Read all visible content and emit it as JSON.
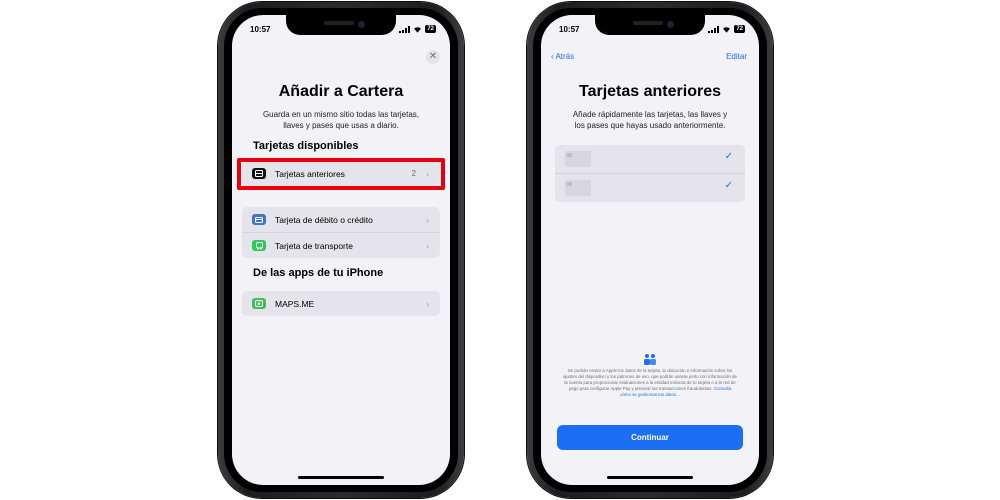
{
  "colors": {
    "accent": "#1f6ff2",
    "highlight": "#e8000c",
    "card_icon": "#3e78c4",
    "transit_icon": "#34c759",
    "maps_icon": "#3fbf57"
  },
  "left": {
    "status": {
      "time": "10:57",
      "battery": "72"
    },
    "close_label": "✕",
    "title": "Añadir a Cartera",
    "description": "Guarda en un mismo sitio todas las tarjetas, llaves y pases que usas a diario.",
    "section_available": "Tarjetas disponibles",
    "previous_cards": {
      "label": "Tarjetas anteriores",
      "count": "2",
      "icon": "wallet-icon"
    },
    "rows": [
      {
        "label": "Tarjeta de débito o crédito",
        "icon": "credit-card-icon"
      },
      {
        "label": "Tarjeta de transporte",
        "icon": "train-icon"
      }
    ],
    "section_apps": "De las apps de tu iPhone",
    "app": {
      "label": "MAPS.ME",
      "icon": "maps-me-icon"
    }
  },
  "right": {
    "status": {
      "time": "10:57",
      "battery": "72"
    },
    "back_label": "Atrás",
    "edit_label": "Editar",
    "title": "Tarjetas anteriores",
    "description": "Añade rápidamente las tarjetas, las llaves y los pases que hayas usado anteriormente.",
    "checkmark": "✓",
    "privacy_text": "Se podrán enviar a Apple los datos de la tarjeta, la ubicación e información sobre los ajustes del dispositivo y los patrones de uso, que podrán usarse junto con información de la cuenta para proporcionar evaluaciones a la entidad emisora de tu tarjeta o a la red de pago para configurar Apple Pay y prevenir las transacciones fraudulentas.",
    "privacy_link": "Consulta cómo se gestionan tus datos...",
    "continue_label": "Continuar"
  }
}
